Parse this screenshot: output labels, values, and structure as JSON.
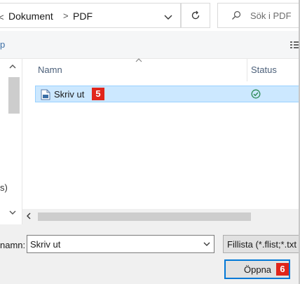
{
  "address_bar": {
    "back_glyph": "<",
    "crumbs": [
      "Dokument",
      "PDF"
    ],
    "separator": ">",
    "search_placeholder": "Sök i PDF"
  },
  "toolbar": {
    "clipped_label": "p"
  },
  "nav_pane": {
    "clipped_text": "s)"
  },
  "file_list": {
    "columns": [
      "Namn",
      "Status"
    ],
    "rows": [
      {
        "name": "Skriv ut",
        "status_icon": "check-circle-icon",
        "selected": true,
        "step_badge": "5"
      }
    ]
  },
  "footer": {
    "filename_label": "namn:",
    "filename_value": "Skriv ut",
    "filter_value": "Fillista (*.flist;*.txt",
    "open_button_label": "Öppna",
    "open_step_badge": "6"
  },
  "colors": {
    "selection_bg": "#cce8ff",
    "selection_border": "#99d1ff",
    "badge_red": "#e1251b",
    "status_green": "#2e8b57",
    "focus_blue": "#0078d7"
  }
}
